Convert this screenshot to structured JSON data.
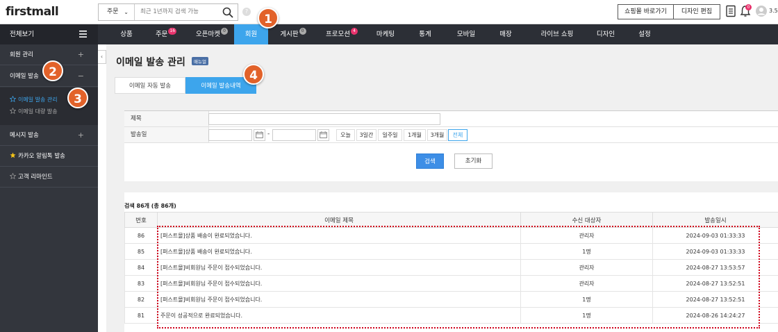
{
  "app": {
    "logo": "firstmall"
  },
  "search": {
    "scope": "주문",
    "placeholder": "최근 1년까지 검색 가능"
  },
  "topbar": {
    "shop_link": "쇼핑몰 바로가기",
    "design_edit": "디자인 편집",
    "notif_count": "0",
    "user": "3.5"
  },
  "nav": {
    "all": "전체보기",
    "items": [
      {
        "label": "상품"
      },
      {
        "label": "주문",
        "badge": "16"
      },
      {
        "label": "오픈마켓",
        "badge": "0"
      },
      {
        "label": "회원"
      },
      {
        "label": "게시판",
        "badge": "0"
      },
      {
        "label": "프로모션",
        "badge": "4"
      },
      {
        "label": "마케팅"
      },
      {
        "label": "통계"
      },
      {
        "label": "모바일"
      },
      {
        "label": "매장"
      },
      {
        "label": "라이브 쇼핑"
      },
      {
        "label": "디자인"
      },
      {
        "label": "설정"
      }
    ]
  },
  "sidebar": {
    "member_mgmt": "회원 관리",
    "email_send": "이메일 발송",
    "sub_email_mgmt": "이메일 발송 관리",
    "sub_email_bulk": "이메일 대량 발송",
    "msg_send": "메시지 발송",
    "kakao": "카카오 알림톡 발송",
    "reminder": "고객 리마인드",
    "plus": "+",
    "minus": "−"
  },
  "page": {
    "title": "이메일 발송 관리",
    "manual_badge": "매뉴얼"
  },
  "tabs": {
    "auto": "이메일 자동 발송",
    "history": "이메일 발송내역"
  },
  "filter": {
    "subject_label": "제목",
    "date_label": "발송일",
    "ranges": [
      "오늘",
      "3일간",
      "일주일",
      "1개월",
      "3개월",
      "전체"
    ],
    "search_btn": "검색",
    "reset_btn": "초기화"
  },
  "results": {
    "count_text": "검색 86개 (총 86개)",
    "headers": [
      "번호",
      "이메일 제목",
      "수신 대상자",
      "발송일시"
    ],
    "rows": [
      {
        "no": "86",
        "subject": "[퍼스트몰]상품 배송이 완료되었습니다.",
        "target": "관리자",
        "date": "2024-09-03 01:33:33"
      },
      {
        "no": "85",
        "subject": "[퍼스트몰]상품 배송이 완료되었습니다.",
        "target": "1명",
        "date": "2024-09-03 01:33:33"
      },
      {
        "no": "84",
        "subject": "[퍼스트몰]비회원님 주문이 접수되었습니다.",
        "target": "관리자",
        "date": "2024-08-27 13:53:57"
      },
      {
        "no": "83",
        "subject": "[퍼스트몰]비회원님 주문이 접수되었습니다.",
        "target": "관리자",
        "date": "2024-08-27 13:52:51"
      },
      {
        "no": "82",
        "subject": "[퍼스트몰]비회원님 주문이 접수되었습니다.",
        "target": "1명",
        "date": "2024-08-27 13:52:51"
      },
      {
        "no": "81",
        "subject": "주문이 성공적으로 완료되었습니다.",
        "target": "1명",
        "date": "2024-08-26 14:24:27"
      }
    ]
  },
  "markers": [
    "1",
    "2",
    "3",
    "4"
  ]
}
